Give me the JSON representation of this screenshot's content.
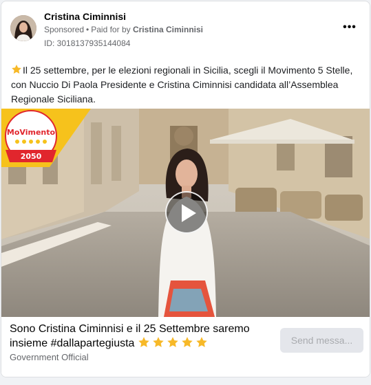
{
  "advertiser": {
    "name": "Cristina Ciminnisi",
    "sponsored_label": "Sponsored",
    "separator": "•",
    "paid_for_by_label": "Paid for by",
    "paid_for_by_name": "Cristina Ciminnisi",
    "ad_id": "ID: 3018137935144084",
    "more_label": "•••"
  },
  "post": {
    "text": "Il 25 settembre, per le elezioni regionali in Sicilia, scegli il Movimento 5 Stelle, con Nuccio Di Paola Presidente e Cristina Ciminnisi candidata all’Assemblea Regionale Siciliana."
  },
  "video": {
    "logo_text": "MoVimento",
    "logo_year": "2050"
  },
  "footer": {
    "headline": "Sono Cristina Ciminnisi e il 25 Settembre saremo insieme #dallapartegiusta",
    "star_rating": 5,
    "subtitle": "Government Official",
    "cta_label": "Send messa..."
  },
  "colors": {
    "logo_red": "#e1262d",
    "logo_yellow": "#f6c21c",
    "star_yellow": "#f7b928",
    "cta_bg": "#e4e6eb"
  },
  "icons": [
    "star-emoji-icon",
    "play-icon",
    "more-options-icon"
  ]
}
